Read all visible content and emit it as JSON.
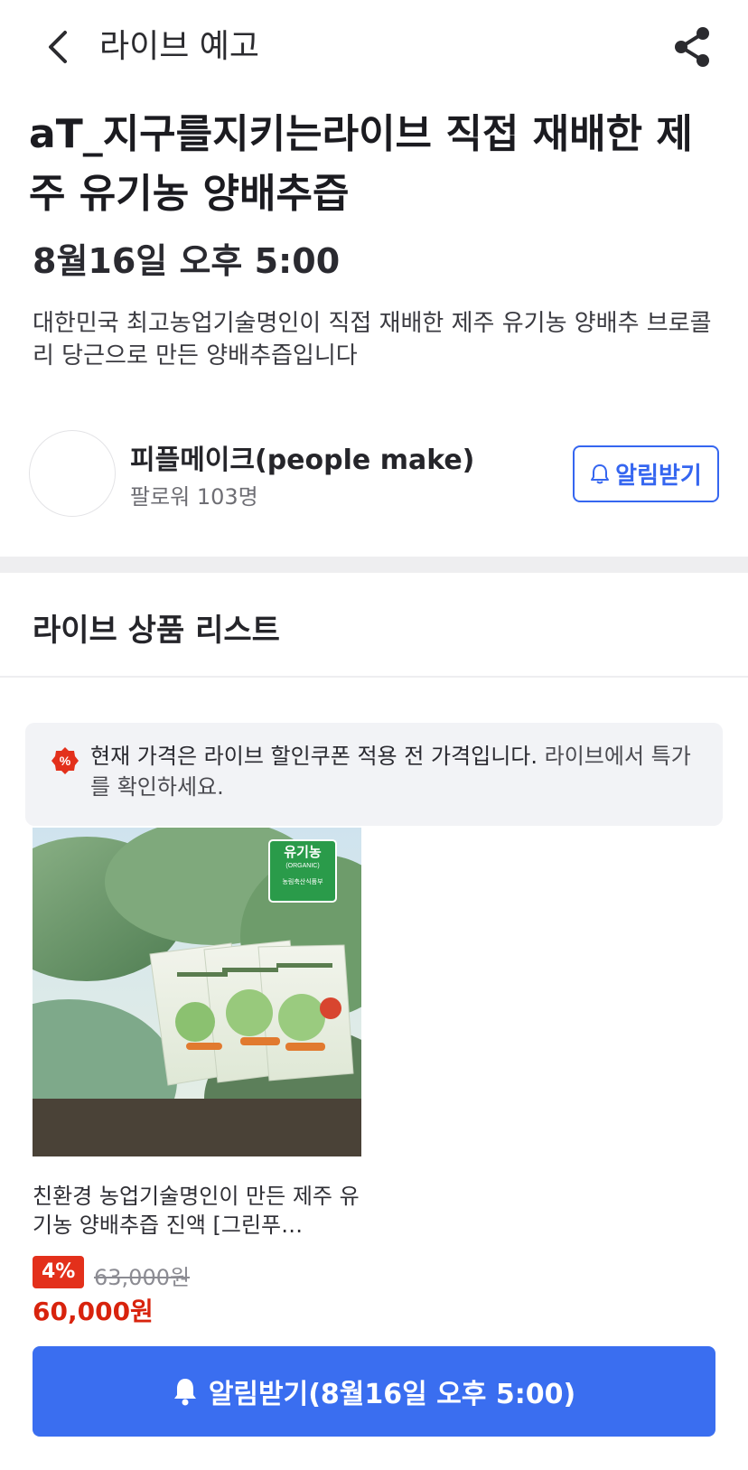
{
  "header": {
    "title": "라이브 예고",
    "back_icon": "chevron-left-icon",
    "share_icon": "share-icon"
  },
  "live": {
    "title": "aT_지구를지키는라이브 직접 재배한 제주 유기농 양배추즙",
    "time": "8월16일 오후 5:00",
    "description": "대한민국 최고농업기술명인이 직접 재배한 제주 유기농 양배추 브로콜리 당근으로 만든 양배추즙입니다"
  },
  "seller": {
    "name": "피플메이크(people make)",
    "followers": "팔로워 103명",
    "notify_label": "알림받기",
    "notify_icon": "bell-icon"
  },
  "section": {
    "title": "라이브 상품 리스트"
  },
  "notice": {
    "icon": "discount-percent-icon",
    "strong_text": "현재 가격은 라이브 할인쿠폰 적용 전 가격입니다.",
    "text": " 라이브에서 특가를 확인하세요."
  },
  "product": {
    "image_label": "유기농",
    "image_label_sub": "(ORGANIC)",
    "image_label_ministry": "농림축산식품부",
    "name": "친환경 농업기술명인이 만든 제주 유기농 양배추즙 진액 [그린푸…",
    "discount": "4%",
    "original_price": "63,000원",
    "final_price": "60,000원"
  },
  "cta": {
    "label": "알림받기(8월16일 오후 5:00)",
    "icon": "bell-filled-icon"
  },
  "colors": {
    "accent": "#3a6ef0",
    "discount": "#e3301b",
    "price": "#d8230d"
  }
}
